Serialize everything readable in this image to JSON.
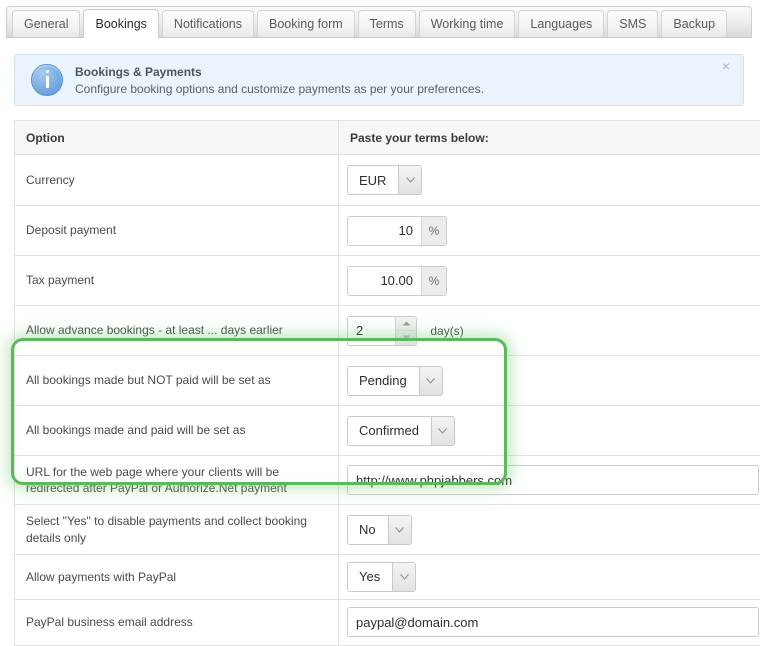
{
  "tabs": [
    {
      "label": "General",
      "active": false
    },
    {
      "label": "Bookings",
      "active": true
    },
    {
      "label": "Notifications",
      "active": false
    },
    {
      "label": "Booking form",
      "active": false
    },
    {
      "label": "Terms",
      "active": false
    },
    {
      "label": "Working time",
      "active": false
    },
    {
      "label": "Languages",
      "active": false
    },
    {
      "label": "SMS",
      "active": false
    },
    {
      "label": "Backup",
      "active": false
    }
  ],
  "banner": {
    "icon": "info-icon",
    "title": "Bookings & Payments",
    "subtitle": "Configure booking options and customize payments as per your preferences.",
    "close_label": "×",
    "background": "#eaf4fa",
    "border_color": "#cfe3ef"
  },
  "table": {
    "headers": {
      "option": "Option",
      "value": "Paste your terms below:"
    },
    "rows": {
      "currency": {
        "label": "Currency",
        "value": "EUR",
        "control": "select"
      },
      "deposit": {
        "label": "Deposit payment",
        "value": "10",
        "suffix": "%",
        "control": "number-with-suffix"
      },
      "tax": {
        "label": "Tax payment",
        "value": "10.00",
        "suffix": "%",
        "control": "number-with-suffix"
      },
      "advance": {
        "label": "Allow advance bookings - at least ... days earlier",
        "value": "2",
        "unit": "day(s)",
        "control": "spinner"
      },
      "not_paid_status": {
        "label": "All bookings made but NOT paid will be set as",
        "value": "Pending",
        "control": "select"
      },
      "paid_status": {
        "label": "All bookings made and paid will be set as",
        "value": "Confirmed",
        "control": "select"
      },
      "redirect_url": {
        "label": "URL for the web page where your clients will be redirected after PayPal or Authorize.Net payment",
        "value": "http://www.phpjabbers.com",
        "control": "text"
      },
      "disable_payments": {
        "label": "Select \"Yes\" to disable payments and collect booking details only",
        "value": "No",
        "control": "select"
      },
      "allow_paypal": {
        "label": "Allow payments with PayPal",
        "value": "Yes",
        "control": "select"
      },
      "paypal_email": {
        "label": "PayPal business email address",
        "value": "paypal@domain.com",
        "control": "text"
      }
    }
  },
  "highlight": {
    "color": "#5cb85c",
    "glow": "rgba(110,200,110,0.38)"
  }
}
